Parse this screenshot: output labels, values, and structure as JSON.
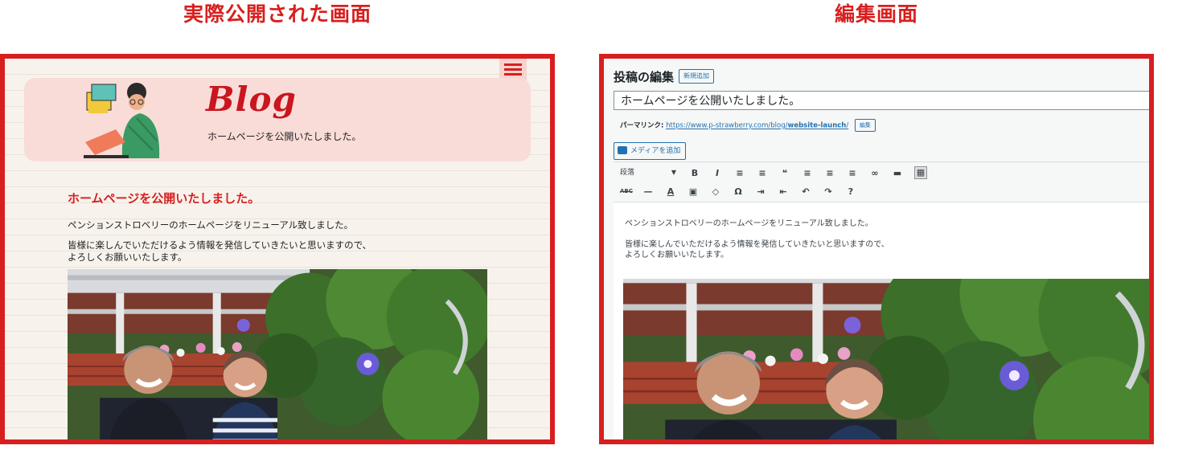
{
  "headings": {
    "published": "実際公開された画面",
    "editor": "編集画面"
  },
  "published_page": {
    "logo": "Blog",
    "banner_subtitle": "ホームページを公開いたしました。",
    "post_title": "ホームページを公開いたしました。",
    "paragraphs": [
      "ペンションストロベリーのホームページをリニューアル致しました。",
      "皆様に楽しんでいただけるよう情報を発信していきたいと思いますので、",
      "よろしくお願いいたします。"
    ]
  },
  "editor": {
    "header": "投稿の編集",
    "new_button": "新規追加",
    "title_value": "ホームページを公開いたしました。",
    "permalink_label": "パーマリンク:",
    "permalink_base": "https://www.p-strawberry.com/blog/",
    "permalink_slug": "website-launch",
    "permalink_end": "/",
    "edit_button": "編集",
    "media_button": "メディアを追加",
    "format_select": "段落",
    "toolbar_row1": [
      "B",
      "I",
      "≡",
      "≡",
      "❝",
      "≡",
      "≡",
      "≡",
      "∞",
      "▬",
      "▦"
    ],
    "toolbar_row2": [
      "ABC",
      "—",
      "A",
      "▣",
      "◇",
      "Ω",
      "⇥",
      "⇤",
      "↶",
      "↷",
      "?"
    ],
    "paragraphs": [
      "ペンションストロベリーのホームページをリニューアル致しました。",
      "皆様に楽しんでいただけるよう情報を発信していきたいと思いますので、",
      "よろしくお願いいたします。"
    ]
  },
  "colors": {
    "accent_red": "#d71f1f",
    "banner_pink": "#f9dcd8",
    "wp_blue": "#2271b1"
  }
}
